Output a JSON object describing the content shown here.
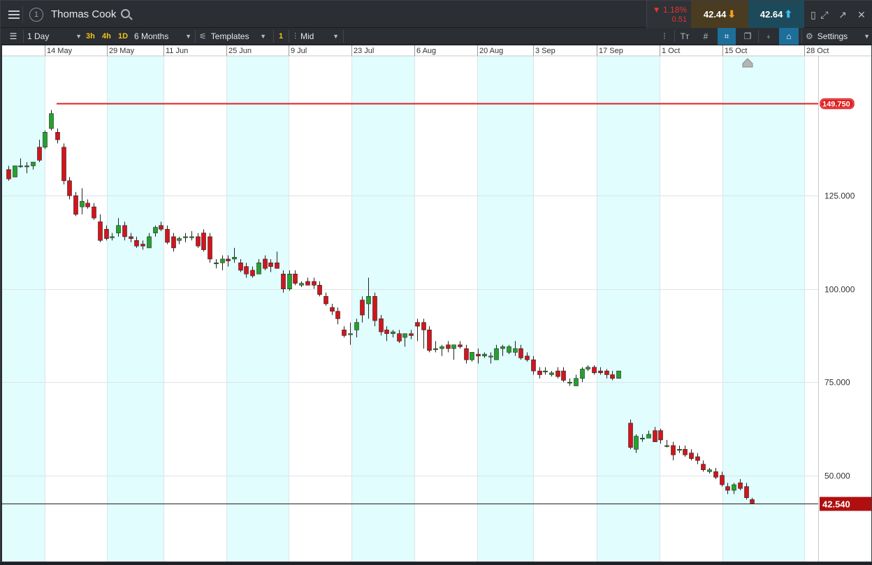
{
  "title": "Thomas Cook",
  "change": {
    "percent": "1.18%",
    "value": "0.51",
    "direction": "down"
  },
  "sell": {
    "price": "42.44"
  },
  "buy": {
    "price": "42.64"
  },
  "toolbar": {
    "interval": "1 Day",
    "quick_intervals": [
      "3h",
      "4h",
      "1D"
    ],
    "range": "6 Months",
    "templates": "Templates",
    "badge": "1",
    "price_type": "Mid",
    "settings": "Settings"
  },
  "colors": {
    "up": "#23a32e",
    "down": "#d4141c",
    "shade": "#e1fdfe",
    "hline": "#e02020",
    "last_tag": "#b00f0f"
  },
  "chart_data": {
    "type": "candlestick",
    "x_tick_labels": [
      "14 May",
      "29 May",
      "11 Jun",
      "25 Jun",
      "9 Jul",
      "23 Jul",
      "6 Aug",
      "20 Aug",
      "3 Sep",
      "17 Sep",
      "1 Oct",
      "15 Oct",
      "28 Oct"
    ],
    "y_tick_labels": [
      "125.000",
      "100.000",
      "75.000",
      "50.000"
    ],
    "ylim": [
      25.2,
      163.8
    ],
    "horizontal_line": {
      "value": 149.75,
      "label": "149.750"
    },
    "last_price": {
      "value": 42.54,
      "label": "42.540"
    },
    "candles": [
      [
        132,
        133,
        129,
        129.5
      ],
      [
        130,
        133,
        130,
        133
      ],
      [
        133,
        135,
        132.5,
        133
      ],
      [
        133,
        134,
        131,
        133
      ],
      [
        133,
        134,
        132,
        134
      ],
      [
        138,
        140,
        134,
        134.5
      ],
      [
        138,
        142.5,
        137.5,
        142
      ],
      [
        143,
        148,
        142.5,
        147
      ],
      [
        142,
        143,
        139,
        140
      ],
      [
        138,
        139,
        128,
        129
      ],
      [
        129,
        130,
        124,
        125
      ],
      [
        125,
        126,
        119.5,
        120
      ],
      [
        122,
        127,
        120,
        123.5
      ],
      [
        123,
        124,
        121.5,
        122
      ],
      [
        122,
        123,
        118.5,
        119
      ],
      [
        118,
        120,
        112.5,
        113
      ],
      [
        116,
        117,
        113,
        113.5
      ],
      [
        114,
        115,
        113,
        114
      ],
      [
        115,
        119,
        114,
        117
      ],
      [
        117,
        118,
        113,
        114
      ],
      [
        114,
        115,
        112.5,
        113.5
      ],
      [
        113,
        114,
        111,
        111.5
      ],
      [
        112,
        113,
        110.5,
        111.5
      ],
      [
        111,
        115,
        111,
        114
      ],
      [
        115,
        117,
        114,
        116.5
      ],
      [
        117,
        118,
        115.5,
        116
      ],
      [
        116,
        117,
        112,
        112.5
      ],
      [
        114,
        115,
        110,
        111
      ],
      [
        113,
        114,
        112,
        113.5
      ],
      [
        114,
        115,
        112.5,
        114
      ],
      [
        114,
        115.5,
        113,
        114
      ],
      [
        114,
        115,
        111,
        111.5
      ],
      [
        115,
        116,
        110,
        110.5
      ],
      [
        114,
        115,
        107,
        108
      ],
      [
        107,
        108,
        105.5,
        107
      ],
      [
        107,
        109,
        105,
        108
      ],
      [
        108,
        109,
        106,
        107.5
      ],
      [
        108,
        111,
        107,
        108.5
      ],
      [
        107,
        108,
        104.5,
        105
      ],
      [
        106,
        107,
        103,
        104
      ],
      [
        105,
        106,
        103,
        103.5
      ],
      [
        104,
        108,
        104,
        107
      ],
      [
        108,
        109,
        105,
        105.5
      ],
      [
        107,
        108,
        104.5,
        106
      ],
      [
        107,
        110,
        106,
        105.5
      ],
      [
        104,
        105,
        99,
        100
      ],
      [
        100,
        105,
        99.5,
        104
      ],
      [
        104,
        105,
        101,
        101.5
      ],
      [
        101,
        102,
        100.5,
        101.5
      ],
      [
        102,
        103,
        101,
        101
      ],
      [
        102,
        103,
        100,
        101
      ],
      [
        101,
        102,
        98,
        98.5
      ],
      [
        98,
        99,
        95.5,
        96
      ],
      [
        95,
        96,
        93,
        94
      ],
      [
        94,
        95,
        90.5,
        92
      ],
      [
        89,
        90,
        87,
        87.5
      ],
      [
        88,
        91,
        85,
        88
      ],
      [
        89,
        92,
        87,
        91
      ],
      [
        97,
        98,
        91,
        93
      ],
      [
        96,
        103,
        92,
        98
      ],
      [
        98,
        99,
        90,
        91.5
      ],
      [
        92,
        93,
        87.5,
        88.5
      ],
      [
        89,
        90,
        86,
        88
      ],
      [
        88,
        89,
        87,
        88.5
      ],
      [
        88,
        89,
        85.5,
        86
      ],
      [
        87,
        88,
        84.5,
        88
      ],
      [
        88,
        89,
        86.5,
        87.5
      ],
      [
        91,
        92,
        86,
        90
      ],
      [
        91,
        92,
        84,
        89
      ],
      [
        89,
        90,
        83,
        83.5
      ],
      [
        84,
        86,
        83,
        84
      ],
      [
        84,
        85,
        82,
        84.5
      ],
      [
        85,
        86,
        83,
        84
      ],
      [
        84,
        85,
        81,
        85
      ],
      [
        85,
        86,
        84,
        84.5
      ],
      [
        84,
        85,
        80,
        81
      ],
      [
        81,
        82,
        80.5,
        83
      ],
      [
        82.5,
        84,
        80,
        82
      ],
      [
        82,
        83,
        81.5,
        82.5
      ],
      [
        82,
        83,
        80,
        82
      ],
      [
        81,
        85,
        81,
        84
      ],
      [
        84,
        85,
        82,
        84.5
      ],
      [
        83,
        85,
        82.5,
        84.5
      ],
      [
        83,
        86,
        82,
        84
      ],
      [
        84,
        85,
        81,
        81.5
      ],
      [
        82,
        83,
        80.5,
        81
      ],
      [
        81,
        82,
        77,
        78
      ],
      [
        78,
        79,
        76,
        77
      ],
      [
        78,
        79,
        77,
        78
      ],
      [
        77,
        78,
        76.5,
        77.5
      ],
      [
        78,
        79,
        76,
        76.5
      ],
      [
        78,
        79,
        75,
        75.5
      ],
      [
        75,
        76,
        74,
        75
      ],
      [
        74,
        77,
        74,
        76
      ],
      [
        76,
        79,
        75,
        78.5
      ],
      [
        78.5,
        79.5,
        78,
        79
      ],
      [
        79,
        79.5,
        77,
        77.5
      ],
      [
        78,
        79,
        77,
        77.5
      ],
      [
        78,
        78.5,
        76,
        77
      ],
      [
        77,
        78,
        75.5,
        76
      ],
      [
        76,
        78,
        76,
        78
      ],
      [
        64,
        65,
        57,
        57.5
      ],
      [
        57,
        61,
        56,
        60.5
      ],
      [
        60,
        61,
        59,
        60
      ],
      [
        60,
        62,
        60,
        61
      ],
      [
        62,
        63,
        59,
        59
      ],
      [
        62,
        62.5,
        58.5,
        59.5
      ],
      [
        58,
        59.5,
        57.5,
        58
      ],
      [
        58,
        59,
        54,
        55.5
      ],
      [
        57,
        58,
        56,
        57
      ],
      [
        57,
        58,
        55,
        55.5
      ],
      [
        56,
        57,
        54,
        54.5
      ],
      [
        55,
        56,
        53,
        54
      ],
      [
        53,
        54,
        51,
        51.5
      ],
      [
        51,
        52,
        50.5,
        51.5
      ],
      [
        51,
        52,
        49,
        49.5
      ],
      [
        50,
        51,
        47,
        47.5
      ],
      [
        47,
        48,
        45,
        46
      ],
      [
        46,
        48,
        45,
        47.5
      ],
      [
        48,
        49,
        46,
        46.5
      ],
      [
        47,
        48,
        43.5,
        44
      ],
      [
        43.5,
        44,
        42.4,
        42.54
      ]
    ]
  }
}
